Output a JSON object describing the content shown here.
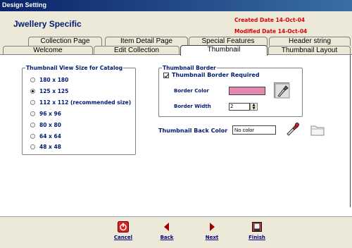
{
  "window": {
    "title": "Design Setting"
  },
  "header": {
    "collection_name": "Jwellery Specific",
    "created": "Created Date 14-Oct-04",
    "modified": "Modified Date 14-Oct-04"
  },
  "tabs": {
    "row1": [
      {
        "label": "Collection Page"
      },
      {
        "label": "Item Detail Page"
      },
      {
        "label": "Special Features"
      },
      {
        "label": "Header string"
      }
    ],
    "row2": [
      {
        "label": "Welcome"
      },
      {
        "label": "Edit Collection"
      },
      {
        "label": "Thumbnail",
        "active": true
      },
      {
        "label": "Thumbnail Layout"
      }
    ]
  },
  "view_size": {
    "legend": "Thumbnail View Size for Catalog",
    "options": [
      {
        "label": "180 x 180",
        "selected": false
      },
      {
        "label": "125 x 125",
        "selected": true
      },
      {
        "label": "112 x 112 (recommended size)",
        "selected": false
      },
      {
        "label": "96 x 96",
        "selected": false
      },
      {
        "label": "80 x 80",
        "selected": false
      },
      {
        "label": "64 x 64",
        "selected": false
      },
      {
        "label": "48 x 48",
        "selected": false
      }
    ]
  },
  "border": {
    "legend": "Thumbnail Border",
    "required_label": "Thumbnail Border Required",
    "required_checked": true,
    "color_label": "Border Color",
    "color_value": "#e48ab2",
    "width_label": "Border Width",
    "width_value": "2"
  },
  "back_color": {
    "label": "Thumbnail Back Color",
    "value": "No color"
  },
  "footer": {
    "cancel": "Cancel",
    "back": "Back",
    "next": "Next",
    "finish": "Finish"
  },
  "colors": {
    "title_bar": "#0a246a",
    "label_text": "#001a70",
    "date_text": "#e00000",
    "cancel_icon": "#e02020",
    "nav_arrow": "#a00000"
  }
}
